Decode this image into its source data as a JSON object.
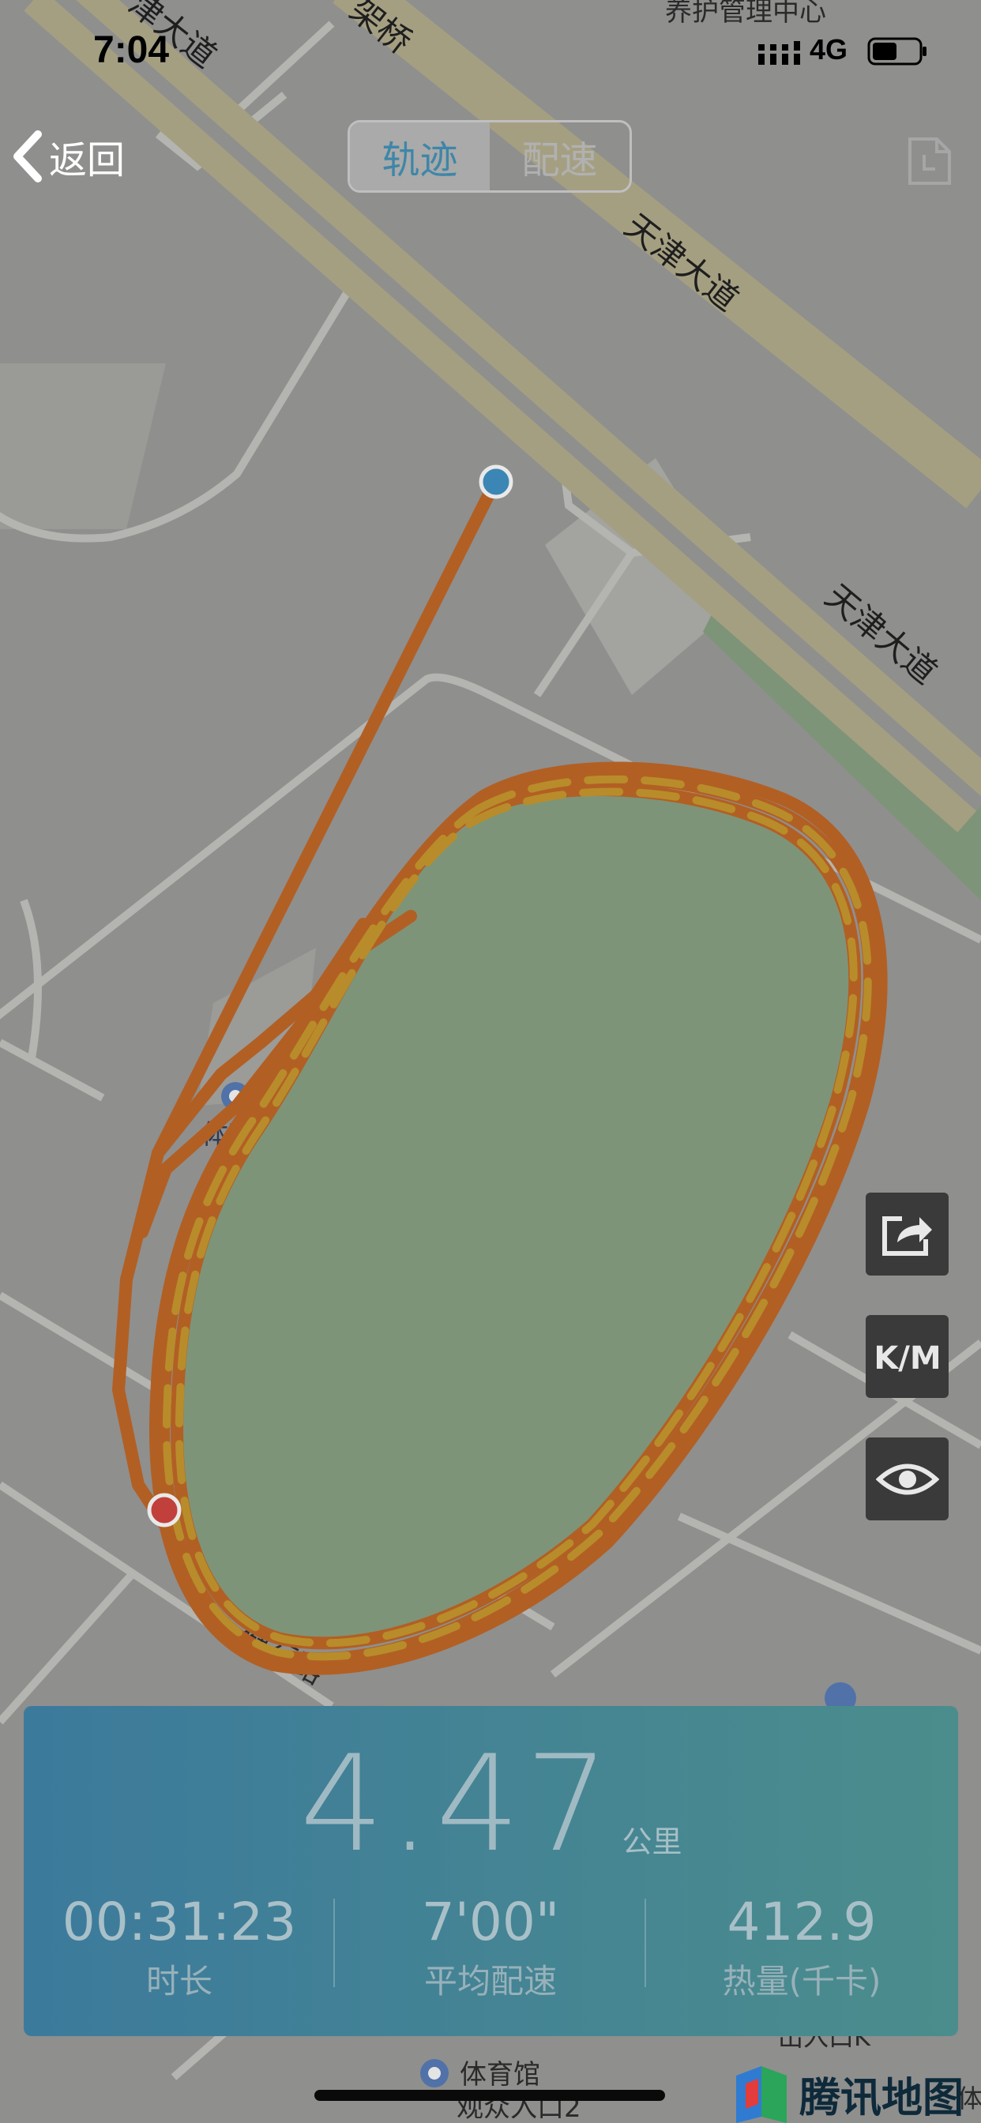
{
  "status_bar": {
    "time": "7:04",
    "network": "4G"
  },
  "nav": {
    "back_label": "返回"
  },
  "tabs": [
    {
      "label": "轨迹",
      "active": true
    },
    {
      "label": "配速",
      "active": false
    }
  ],
  "map": {
    "labels": {
      "road1": "天津大道",
      "road2": "天津大道",
      "road_bottom": "健行路",
      "top_left": "津大道",
      "top_mid": "架桥",
      "top_right": "养护管理中心",
      "poi_stadium": "体育场",
      "poi_gym": "体育馆",
      "poi_gym_entrance": "观众入口2",
      "exit": "出入口K",
      "corner": "体"
    },
    "watermark": "腾讯地图",
    "colors": {
      "track_route": "#b25f24",
      "track_pace": "#b88c2a",
      "field": "#7e9478",
      "start_dot": "#3b86b4",
      "end_dot": "#c2403c"
    }
  },
  "side_buttons": [
    {
      "icon": "share-icon"
    },
    {
      "icon": "km-unit-icon",
      "label": "K/M"
    },
    {
      "icon": "eye-icon"
    }
  ],
  "stats": {
    "distance": "4.47",
    "distance_unit": "公里",
    "duration": "00:31:23",
    "duration_label": "时长",
    "pace": "7'00\"",
    "pace_label": "平均配速",
    "calories": "412.9",
    "calories_label": "热量(千卡)"
  }
}
